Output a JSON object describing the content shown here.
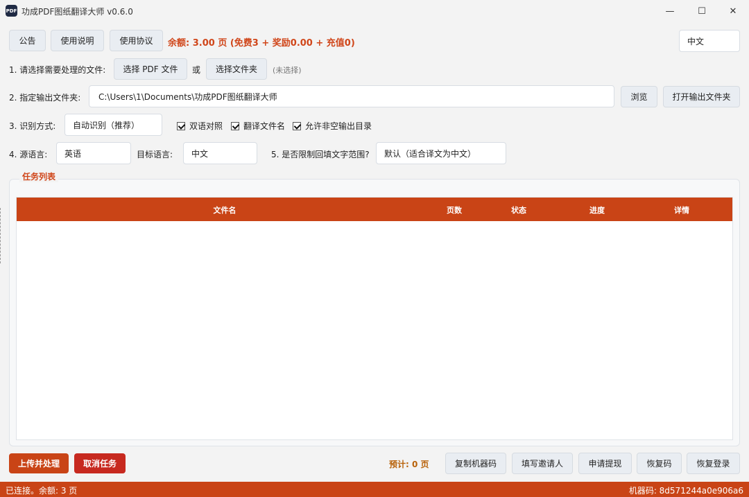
{
  "window": {
    "title": "功成PDF图纸翻译大师 v0.6.0",
    "icon_text": "PDF",
    "minimize_glyph": "—",
    "maximize_glyph": "☐",
    "close_glyph": "✕"
  },
  "toolbar": {
    "notice": "公告",
    "manual": "使用说明",
    "agreement": "使用协议",
    "balance": "余额: 3.00 页 (免费3 + 奖励0.00 + 充值0)",
    "language": "中文"
  },
  "step1": {
    "label": "1. 请选择需要处理的文件:",
    "select_pdf": "选择 PDF 文件",
    "or": "或",
    "select_folder": "选择文件夹",
    "status": "(未选择)"
  },
  "step2": {
    "label": "2. 指定输出文件夹:",
    "path": "C:\\Users\\1\\Documents\\功成PDF图纸翻译大师",
    "browse": "浏览",
    "open_output": "打开输出文件夹"
  },
  "step3": {
    "label": "3. 识别方式:",
    "mode": "自动识别（推荐）",
    "bilingual": "双语对照",
    "translate_filename": "翻译文件名",
    "allow_nonempty_output": "允许非空输出目录"
  },
  "step4": {
    "source_label": "4. 源语言:",
    "source_value": "英语",
    "target_label": "目标语言:",
    "target_value": "中文",
    "range_label": "5. 是否限制回填文字范围?",
    "range_value": "默认（适合译文为中文）"
  },
  "tasks": {
    "title": "任务列表",
    "columns": [
      "文件名",
      "页数",
      "状态",
      "进度",
      "详情"
    ]
  },
  "bottom": {
    "upload": "上传并处理",
    "cancel": "取消任务",
    "estimate": "预计: 0 页",
    "copy_machine_code": "复制机器码",
    "fill_inviter": "填写邀请人",
    "withdraw": "申请提现",
    "recovery_code": "恢复码",
    "restore_login": "恢复登录"
  },
  "status": {
    "left": "已连接。余额: 3 页",
    "right": "机器码: 8d571244a0e906a6"
  },
  "colors": {
    "accent": "#c94416",
    "danger": "#c7291f",
    "estimate": "#b8620a"
  }
}
